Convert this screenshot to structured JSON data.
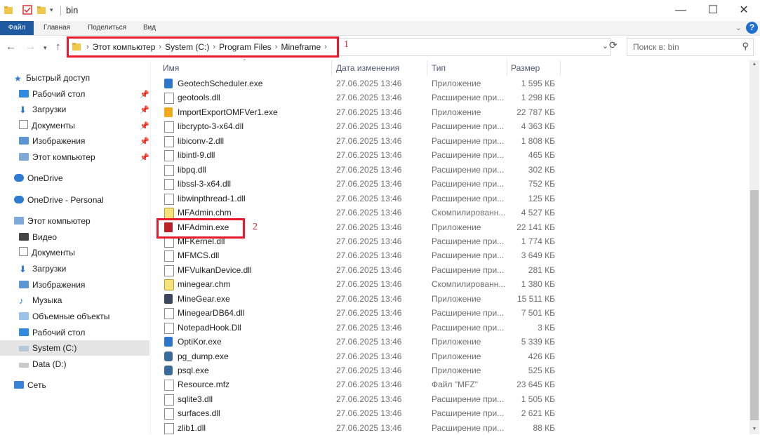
{
  "window": {
    "title": "bin",
    "minimize": "—",
    "maximize": "☐",
    "close": "✕"
  },
  "ribbon": {
    "tabs": [
      "Файл",
      "Главная",
      "Поделиться",
      "Вид"
    ],
    "help": "?"
  },
  "address": {
    "crumbs": [
      "Этот компьютер",
      "System (C:)",
      "Program Files",
      "Mineframe"
    ]
  },
  "annotations": {
    "label1": "1",
    "label2": "2"
  },
  "search": {
    "placeholder": "Поиск в: bin"
  },
  "sidebar": {
    "items": [
      {
        "label": "Быстрый доступ"
      },
      {
        "label": "Рабочий стол"
      },
      {
        "label": "Загрузки"
      },
      {
        "label": "Документы"
      },
      {
        "label": "Изображения"
      },
      {
        "label": "Этот компьютер"
      },
      {
        "label": "OneDrive"
      },
      {
        "label": "OneDrive - Personal"
      },
      {
        "label": "Этот компьютер"
      },
      {
        "label": "Видео"
      },
      {
        "label": "Документы"
      },
      {
        "label": "Загрузки"
      },
      {
        "label": "Изображения"
      },
      {
        "label": "Музыка"
      },
      {
        "label": "Объемные объекты"
      },
      {
        "label": "Рабочий стол"
      },
      {
        "label": "System (C:)"
      },
      {
        "label": "Data (D:)"
      },
      {
        "label": "Сеть"
      }
    ]
  },
  "columns": {
    "name": "Имя",
    "date": "Дата изменения",
    "type": "Тип",
    "size": "Размер"
  },
  "files": [
    {
      "name": "GeotechScheduler.exe",
      "date": "27.06.2025 13:46",
      "type": "Приложение",
      "size": "1 595 КБ"
    },
    {
      "name": "geotools.dll",
      "date": "27.06.2025 13:46",
      "type": "Расширение при...",
      "size": "1 298 КБ"
    },
    {
      "name": "ImportExportOMFVer1.exe",
      "date": "27.06.2025 13:46",
      "type": "Приложение",
      "size": "22 787 КБ"
    },
    {
      "name": "libcrypto-3-x64.dll",
      "date": "27.06.2025 13:46",
      "type": "Расширение при...",
      "size": "4 363 КБ"
    },
    {
      "name": "libiconv-2.dll",
      "date": "27.06.2025 13:46",
      "type": "Расширение при...",
      "size": "1 808 КБ"
    },
    {
      "name": "libintl-9.dll",
      "date": "27.06.2025 13:46",
      "type": "Расширение при...",
      "size": "465 КБ"
    },
    {
      "name": "libpq.dll",
      "date": "27.06.2025 13:46",
      "type": "Расширение при...",
      "size": "302 КБ"
    },
    {
      "name": "libssl-3-x64.dll",
      "date": "27.06.2025 13:46",
      "type": "Расширение при...",
      "size": "752 КБ"
    },
    {
      "name": "libwinpthread-1.dll",
      "date": "27.06.2025 13:46",
      "type": "Расширение при...",
      "size": "125 КБ"
    },
    {
      "name": "MFAdmin.chm",
      "date": "27.06.2025 13:46",
      "type": "Скомпилированн...",
      "size": "4 527 КБ"
    },
    {
      "name": "MFAdmin.exe",
      "date": "27.06.2025 13:46",
      "type": "Приложение",
      "size": "22 141 КБ"
    },
    {
      "name": "MFKernel.dll",
      "date": "27.06.2025 13:46",
      "type": "Расширение при...",
      "size": "1 774 КБ"
    },
    {
      "name": "MFMCS.dll",
      "date": "27.06.2025 13:46",
      "type": "Расширение при...",
      "size": "3 649 КБ"
    },
    {
      "name": "MFVulkanDevice.dll",
      "date": "27.06.2025 13:46",
      "type": "Расширение при...",
      "size": "281 КБ"
    },
    {
      "name": "minegear.chm",
      "date": "27.06.2025 13:46",
      "type": "Скомпилированн...",
      "size": "1 380 КБ"
    },
    {
      "name": "MineGear.exe",
      "date": "27.06.2025 13:46",
      "type": "Приложение",
      "size": "15 511 КБ"
    },
    {
      "name": "MinegearDB64.dll",
      "date": "27.06.2025 13:46",
      "type": "Расширение при...",
      "size": "7 501 КБ"
    },
    {
      "name": "NotepadHook.Dll",
      "date": "27.06.2025 13:46",
      "type": "Расширение при...",
      "size": "3 КБ"
    },
    {
      "name": "OptiKor.exe",
      "date": "27.06.2025 13:46",
      "type": "Приложение",
      "size": "5 339 КБ"
    },
    {
      "name": "pg_dump.exe",
      "date": "27.06.2025 13:46",
      "type": "Приложение",
      "size": "426 КБ"
    },
    {
      "name": "psql.exe",
      "date": "27.06.2025 13:46",
      "type": "Приложение",
      "size": "525 КБ"
    },
    {
      "name": "Resource.mfz",
      "date": "27.06.2025 13:46",
      "type": "Файл \"MFZ\"",
      "size": "23 645 КБ"
    },
    {
      "name": "sqlite3.dll",
      "date": "27.06.2025 13:46",
      "type": "Расширение при...",
      "size": "1 505 КБ"
    },
    {
      "name": "surfaces.dll",
      "date": "27.06.2025 13:46",
      "type": "Расширение при...",
      "size": "2 621 КБ"
    },
    {
      "name": "zlib1.dll",
      "date": "27.06.2025 13:46",
      "type": "Расширение при...",
      "size": "88 КБ"
    }
  ],
  "file_icons": [
    "geotech-exe-icon",
    "dll-icon",
    "importexport-exe-icon",
    "dll-icon",
    "dll-icon",
    "dll-icon",
    "dll-icon",
    "dll-icon",
    "dll-icon",
    "chm-icon",
    "mfadmin-exe-icon",
    "dll-icon",
    "dll-icon",
    "dll-icon",
    "chm-icon",
    "minegear-exe-icon",
    "dll-icon",
    "dll-icon",
    "optikor-exe-icon",
    "postgres-icon",
    "postgres-icon",
    "file-icon",
    "dll-icon",
    "dll-icon",
    "dll-icon"
  ],
  "colors": {
    "accent": "#1f5aa0",
    "annotation": "#e8192c"
  }
}
